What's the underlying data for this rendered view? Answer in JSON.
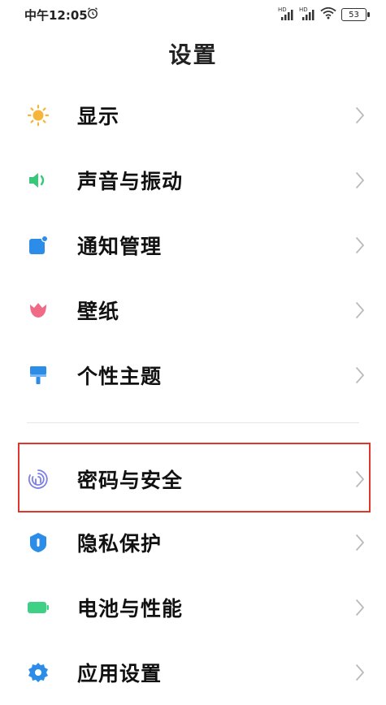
{
  "status_bar": {
    "time": "中午12:05",
    "signal1_label": "HD",
    "signal2_label": "HD",
    "battery": "53"
  },
  "title": "设置",
  "items": [
    {
      "label": "显示",
      "icon": "brightness-icon",
      "color": "#f5b53a"
    },
    {
      "label": "声音与振动",
      "icon": "speaker-icon",
      "color": "#39c87a"
    },
    {
      "label": "通知管理",
      "icon": "notification-icon",
      "color": "#2b8de8"
    },
    {
      "label": "壁纸",
      "icon": "tulip-icon",
      "color": "#f06a88"
    },
    {
      "label": "个性主题",
      "icon": "paintbrush-icon",
      "color": "#2b8de8"
    },
    {
      "label": "密码与安全",
      "icon": "fingerprint-icon",
      "color": "#7b7fe6"
    },
    {
      "label": "隐私保护",
      "icon": "shield-icon",
      "color": "#2b8de8"
    },
    {
      "label": "电池与性能",
      "icon": "battery-icon",
      "color": "#3fd086"
    },
    {
      "label": "应用设置",
      "icon": "gear-icon",
      "color": "#2b8de8"
    }
  ],
  "highlight_color": "#e0362b"
}
